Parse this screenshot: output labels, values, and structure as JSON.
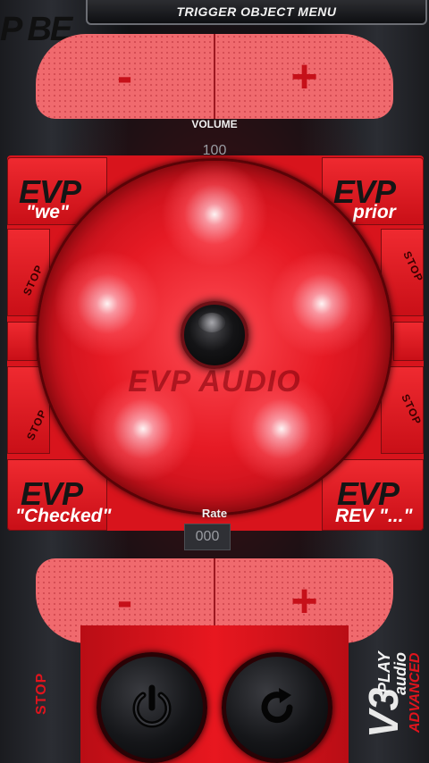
{
  "header": {
    "menu_title": "TRIGGER OBJECT MENU",
    "partial_logo": "P BE"
  },
  "volume": {
    "label": "VOLUME",
    "value": "100",
    "minus": "-",
    "plus": "+"
  },
  "rate": {
    "label": "Rate",
    "value": "000",
    "minus": "-",
    "plus": "+"
  },
  "disc": {
    "title": "EVP AUDIO"
  },
  "tiles": {
    "evp_label": "EVP",
    "top_left": "\"we\"",
    "top_right": "prior",
    "bottom_left": "\"Checked\"",
    "bottom_right": "REV \"...\"",
    "stop": "STOP"
  },
  "controls": {
    "stop": "STOP"
  },
  "brand": {
    "version": "V3",
    "play": "PLAY",
    "audio": "audio",
    "advanced": "ADVANCED"
  },
  "colors": {
    "accent": "#e0141d",
    "pad": "#f06a6e",
    "dark": "#101114"
  }
}
